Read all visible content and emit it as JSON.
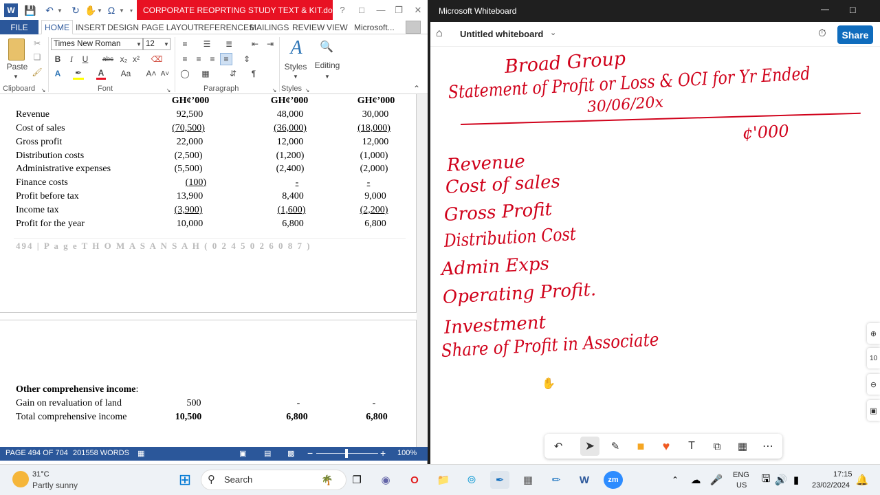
{
  "word": {
    "title": "CORPORATE REOPRTING STUDY TEXT & KIT.docx - ...",
    "help": "?",
    "ribbon_tabs": [
      "FILE",
      "HOME",
      "INSERT",
      "DESIGN",
      "PAGE LAYOUT",
      "REFERENCES",
      "MAILINGS",
      "REVIEW",
      "VIEW",
      "Microsoft..."
    ],
    "ribbon": {
      "paste": "Paste",
      "font_name": "Times New Roman",
      "font_size": "12",
      "styles": "Styles",
      "editing": "Editing",
      "groups": [
        "Clipboard",
        "Font",
        "Paragraph",
        "Styles"
      ]
    },
    "table": {
      "headers": [
        "GH¢’000",
        "GH¢’000",
        "GH¢’000"
      ],
      "rows": [
        {
          "label": "Revenue",
          "v": [
            "92,500",
            "48,000",
            "30,000"
          ]
        },
        {
          "label": "Cost of sales",
          "v": [
            "(70,500)",
            "(36,000)",
            "(18,000)"
          ]
        },
        {
          "label": "Gross profit",
          "v": [
            "22,000",
            "12,000",
            "12,000"
          ]
        },
        {
          "label": "Distribution costs",
          "v": [
            "(2,500)",
            "(1,200)",
            "(1,000)"
          ]
        },
        {
          "label": "Administrative expenses",
          "v": [
            "(5,500)",
            "(2,400)",
            "(2,000)"
          ]
        },
        {
          "label": "Finance costs",
          "v": [
            "(100)",
            "-",
            "-"
          ]
        },
        {
          "label": "Profit before tax",
          "v": [
            "13,900",
            "8,400",
            "9,000"
          ]
        },
        {
          "label": "Income tax",
          "v": [
            "(3,900)",
            "(1,600)",
            "(2,200)"
          ]
        },
        {
          "label": "Profit for the year",
          "v": [
            "10,000",
            "6,800",
            "6,800"
          ]
        }
      ]
    },
    "footer": "494 | P a g e T H O M A S   A N S A H   ( 0 2 4 5 0 2 6 0 8 7 )",
    "oci": {
      "title": "Other comprehensive income",
      "colon": ":",
      "rows": [
        {
          "label": "Gain on revaluation of land",
          "v": [
            "500",
            "-",
            "-"
          ]
        },
        {
          "label": "Total comprehensive income",
          "v": [
            "10,500",
            "6,800",
            "6,800"
          ]
        }
      ]
    },
    "status": {
      "page": "PAGE 494 OF 704",
      "words": "201558 WORDS",
      "zoom": "100%"
    }
  },
  "whiteboard": {
    "app_title": "Microsoft Whiteboard",
    "board_name": "Untitled whiteboard",
    "share": "Share",
    "ink": {
      "title1": "Broad Group",
      "title2": "Statement of Profit or Loss & OCI for Yr Ended",
      "date": "30/06/20x",
      "currency": "¢'000",
      "items": [
        "Revenue",
        "Cost of sales",
        "Gross Profit",
        "Distribution Cost",
        "Admin Exps",
        "Operating Profit.",
        "Investment",
        "Share of Profit in Associate"
      ]
    }
  },
  "taskbar": {
    "weather_temp": "31°C",
    "weather_desc": "Partly sunny",
    "search": "Search",
    "lang1": "ENG",
    "lang2": "US",
    "time": "17:15",
    "date": "23/02/2024"
  },
  "colors": {
    "word_blue": "#2b579a",
    "title_red": "#e81123",
    "ink_red": "#d0021b",
    "share_blue": "#0f6cbd"
  }
}
